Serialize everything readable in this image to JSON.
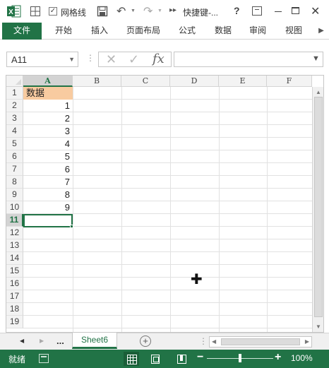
{
  "titlebar": {
    "gridlines_label": "网格线",
    "gridlines_checked": "✓",
    "title": "快捷键-...",
    "help": "?",
    "close": "✕"
  },
  "tabs": [
    "文件",
    "开始",
    "插入",
    "页面布局",
    "公式",
    "数据",
    "审阅",
    "视图"
  ],
  "formula_bar": {
    "namebox": "A11",
    "fx": "fx",
    "formula": ""
  },
  "grid": {
    "columns": [
      "A",
      "B",
      "C",
      "D",
      "E",
      "F"
    ],
    "rows": [
      "1",
      "2",
      "3",
      "4",
      "5",
      "6",
      "7",
      "8",
      "9",
      "10",
      "11",
      "12",
      "13",
      "14",
      "15",
      "16",
      "17",
      "18",
      "19"
    ],
    "selected_column": "A",
    "selected_row": "11",
    "header_cell": "数据",
    "values": [
      "1",
      "2",
      "3",
      "4",
      "5",
      "6",
      "7",
      "8",
      "9"
    ]
  },
  "sheets": {
    "dots": "...",
    "active": "Sheet6",
    "add": "+"
  },
  "status": {
    "ready": "就绪",
    "zoom_minus": "−",
    "zoom_plus": "+",
    "zoom_level": "100%",
    "zoom_value": 100
  },
  "colors": {
    "accent": "#217346",
    "header_fill": "#f8cba0",
    "selected_header": "#d3d3d3"
  }
}
